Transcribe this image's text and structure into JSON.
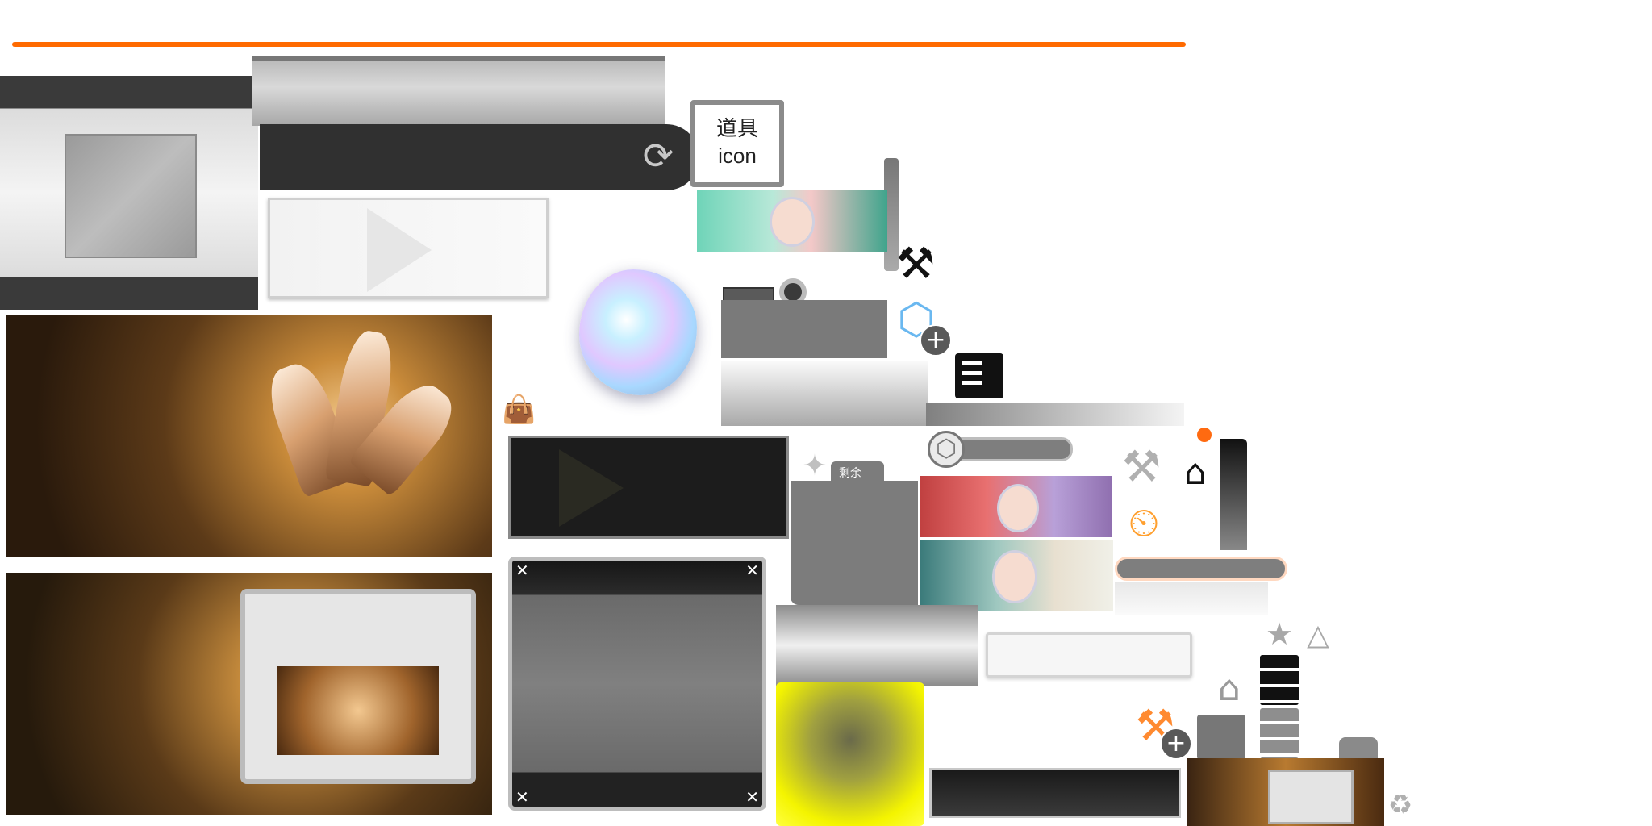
{
  "item_icon": {
    "line1": "道具",
    "line2": "icon"
  },
  "remaining_tab": {
    "label": "剩余"
  },
  "icons": {
    "refresh": "refresh-icon",
    "tools": "tools-icon",
    "cube": "cube-icon",
    "plus": "plus-icon",
    "roster": "roster-icon",
    "clock": "clock-icon",
    "hanger": "hanger-icon",
    "star": "star-icon",
    "server": "server-icon",
    "recycle": "recycle-icon",
    "bag": "bag-icon",
    "badge": "triangle-badge-icon"
  },
  "colors": {
    "accent_orange": "#ff6a00",
    "notify_dot": "#ff6a10",
    "cube_blue": "#6ab8f0",
    "highlight_yellow": "#f4f400",
    "clock_orange": "#ffa030"
  }
}
